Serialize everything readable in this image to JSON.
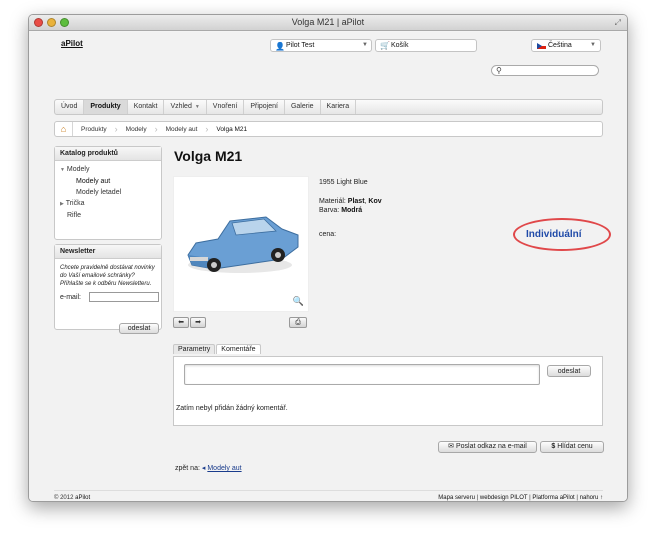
{
  "window": {
    "title": "Volga M21 | aPilot"
  },
  "header": {
    "logo": "aPilot",
    "user": "Pilot Test",
    "cart": "Košík",
    "language": "Čeština"
  },
  "nav": [
    "Úvod",
    "Produkty",
    "Kontakt",
    "Vzhled",
    "Vnoření",
    "Připojení",
    "Galerie",
    "Kariera"
  ],
  "breadcrumbs": [
    "Produkty",
    "Modely",
    "Modely aut",
    "Volga M21"
  ],
  "catalog": {
    "title": "Katalog produktů",
    "items": [
      {
        "label": "Modely",
        "marker": "▼",
        "indent": 0
      },
      {
        "label": "Modely aut",
        "marker": "",
        "indent": 1
      },
      {
        "label": "Modely letadel",
        "marker": "",
        "indent": 1
      },
      {
        "label": "Trička",
        "marker": "▶",
        "indent": 0
      },
      {
        "label": "Rifle",
        "marker": "",
        "indent": 0
      }
    ]
  },
  "newsletter": {
    "title": "Newsletter",
    "text": "Chcete pravidelně dostávat novinky do Vaší emailové schránky? Přihlašte se k odběru Newsletteru.",
    "email_label": "e-mail:",
    "submit": "odeslat"
  },
  "product": {
    "name": "Volga M21",
    "variant": "1955 Light Blue",
    "material_label": "Materiál:",
    "materials": [
      "Plast",
      "Kov"
    ],
    "color_label": "Barva:",
    "color": "Modrá",
    "price_label": "cena:",
    "price": "Individuální"
  },
  "tabs": [
    "Parametry",
    "Komentáře"
  ],
  "comments": {
    "submit": "odeslat",
    "empty": "Zatím nebyl přidán žádný komentář."
  },
  "actions": {
    "send_link": "Poslat odkaz na e-mail",
    "watch_price": "Hlídat cenu"
  },
  "back": {
    "label": "zpět na:",
    "link": "Modely aut"
  },
  "footer": {
    "copyright": "© 2012",
    "copyright_link": "aPilot",
    "links": [
      "Mapa serveru",
      "webdesign PILOT",
      "Platforma aPilot",
      "nahoru ↑"
    ]
  },
  "colors": {
    "price": "#1f4aa8",
    "highlight": "#e0484a"
  }
}
